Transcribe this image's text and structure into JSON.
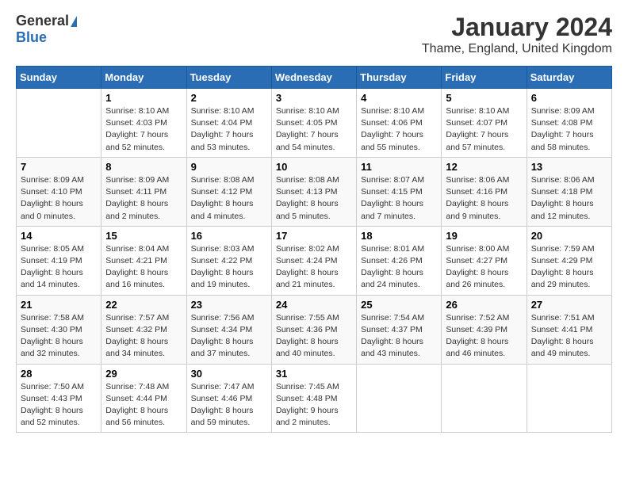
{
  "logo": {
    "general": "General",
    "blue": "Blue"
  },
  "header": {
    "title": "January 2024",
    "subtitle": "Thame, England, United Kingdom"
  },
  "weekdays": [
    "Sunday",
    "Monday",
    "Tuesday",
    "Wednesday",
    "Thursday",
    "Friday",
    "Saturday"
  ],
  "weeks": [
    [
      {
        "day": "",
        "sunrise": "",
        "sunset": "",
        "daylight": ""
      },
      {
        "day": "1",
        "sunrise": "Sunrise: 8:10 AM",
        "sunset": "Sunset: 4:03 PM",
        "daylight": "Daylight: 7 hours and 52 minutes."
      },
      {
        "day": "2",
        "sunrise": "Sunrise: 8:10 AM",
        "sunset": "Sunset: 4:04 PM",
        "daylight": "Daylight: 7 hours and 53 minutes."
      },
      {
        "day": "3",
        "sunrise": "Sunrise: 8:10 AM",
        "sunset": "Sunset: 4:05 PM",
        "daylight": "Daylight: 7 hours and 54 minutes."
      },
      {
        "day": "4",
        "sunrise": "Sunrise: 8:10 AM",
        "sunset": "Sunset: 4:06 PM",
        "daylight": "Daylight: 7 hours and 55 minutes."
      },
      {
        "day": "5",
        "sunrise": "Sunrise: 8:10 AM",
        "sunset": "Sunset: 4:07 PM",
        "daylight": "Daylight: 7 hours and 57 minutes."
      },
      {
        "day": "6",
        "sunrise": "Sunrise: 8:09 AM",
        "sunset": "Sunset: 4:08 PM",
        "daylight": "Daylight: 7 hours and 58 minutes."
      }
    ],
    [
      {
        "day": "7",
        "sunrise": "Sunrise: 8:09 AM",
        "sunset": "Sunset: 4:10 PM",
        "daylight": "Daylight: 8 hours and 0 minutes."
      },
      {
        "day": "8",
        "sunrise": "Sunrise: 8:09 AM",
        "sunset": "Sunset: 4:11 PM",
        "daylight": "Daylight: 8 hours and 2 minutes."
      },
      {
        "day": "9",
        "sunrise": "Sunrise: 8:08 AM",
        "sunset": "Sunset: 4:12 PM",
        "daylight": "Daylight: 8 hours and 4 minutes."
      },
      {
        "day": "10",
        "sunrise": "Sunrise: 8:08 AM",
        "sunset": "Sunset: 4:13 PM",
        "daylight": "Daylight: 8 hours and 5 minutes."
      },
      {
        "day": "11",
        "sunrise": "Sunrise: 8:07 AM",
        "sunset": "Sunset: 4:15 PM",
        "daylight": "Daylight: 8 hours and 7 minutes."
      },
      {
        "day": "12",
        "sunrise": "Sunrise: 8:06 AM",
        "sunset": "Sunset: 4:16 PM",
        "daylight": "Daylight: 8 hours and 9 minutes."
      },
      {
        "day": "13",
        "sunrise": "Sunrise: 8:06 AM",
        "sunset": "Sunset: 4:18 PM",
        "daylight": "Daylight: 8 hours and 12 minutes."
      }
    ],
    [
      {
        "day": "14",
        "sunrise": "Sunrise: 8:05 AM",
        "sunset": "Sunset: 4:19 PM",
        "daylight": "Daylight: 8 hours and 14 minutes."
      },
      {
        "day": "15",
        "sunrise": "Sunrise: 8:04 AM",
        "sunset": "Sunset: 4:21 PM",
        "daylight": "Daylight: 8 hours and 16 minutes."
      },
      {
        "day": "16",
        "sunrise": "Sunrise: 8:03 AM",
        "sunset": "Sunset: 4:22 PM",
        "daylight": "Daylight: 8 hours and 19 minutes."
      },
      {
        "day": "17",
        "sunrise": "Sunrise: 8:02 AM",
        "sunset": "Sunset: 4:24 PM",
        "daylight": "Daylight: 8 hours and 21 minutes."
      },
      {
        "day": "18",
        "sunrise": "Sunrise: 8:01 AM",
        "sunset": "Sunset: 4:26 PM",
        "daylight": "Daylight: 8 hours and 24 minutes."
      },
      {
        "day": "19",
        "sunrise": "Sunrise: 8:00 AM",
        "sunset": "Sunset: 4:27 PM",
        "daylight": "Daylight: 8 hours and 26 minutes."
      },
      {
        "day": "20",
        "sunrise": "Sunrise: 7:59 AM",
        "sunset": "Sunset: 4:29 PM",
        "daylight": "Daylight: 8 hours and 29 minutes."
      }
    ],
    [
      {
        "day": "21",
        "sunrise": "Sunrise: 7:58 AM",
        "sunset": "Sunset: 4:30 PM",
        "daylight": "Daylight: 8 hours and 32 minutes."
      },
      {
        "day": "22",
        "sunrise": "Sunrise: 7:57 AM",
        "sunset": "Sunset: 4:32 PM",
        "daylight": "Daylight: 8 hours and 34 minutes."
      },
      {
        "day": "23",
        "sunrise": "Sunrise: 7:56 AM",
        "sunset": "Sunset: 4:34 PM",
        "daylight": "Daylight: 8 hours and 37 minutes."
      },
      {
        "day": "24",
        "sunrise": "Sunrise: 7:55 AM",
        "sunset": "Sunset: 4:36 PM",
        "daylight": "Daylight: 8 hours and 40 minutes."
      },
      {
        "day": "25",
        "sunrise": "Sunrise: 7:54 AM",
        "sunset": "Sunset: 4:37 PM",
        "daylight": "Daylight: 8 hours and 43 minutes."
      },
      {
        "day": "26",
        "sunrise": "Sunrise: 7:52 AM",
        "sunset": "Sunset: 4:39 PM",
        "daylight": "Daylight: 8 hours and 46 minutes."
      },
      {
        "day": "27",
        "sunrise": "Sunrise: 7:51 AM",
        "sunset": "Sunset: 4:41 PM",
        "daylight": "Daylight: 8 hours and 49 minutes."
      }
    ],
    [
      {
        "day": "28",
        "sunrise": "Sunrise: 7:50 AM",
        "sunset": "Sunset: 4:43 PM",
        "daylight": "Daylight: 8 hours and 52 minutes."
      },
      {
        "day": "29",
        "sunrise": "Sunrise: 7:48 AM",
        "sunset": "Sunset: 4:44 PM",
        "daylight": "Daylight: 8 hours and 56 minutes."
      },
      {
        "day": "30",
        "sunrise": "Sunrise: 7:47 AM",
        "sunset": "Sunset: 4:46 PM",
        "daylight": "Daylight: 8 hours and 59 minutes."
      },
      {
        "day": "31",
        "sunrise": "Sunrise: 7:45 AM",
        "sunset": "Sunset: 4:48 PM",
        "daylight": "Daylight: 9 hours and 2 minutes."
      },
      {
        "day": "",
        "sunrise": "",
        "sunset": "",
        "daylight": ""
      },
      {
        "day": "",
        "sunrise": "",
        "sunset": "",
        "daylight": ""
      },
      {
        "day": "",
        "sunrise": "",
        "sunset": "",
        "daylight": ""
      }
    ]
  ]
}
